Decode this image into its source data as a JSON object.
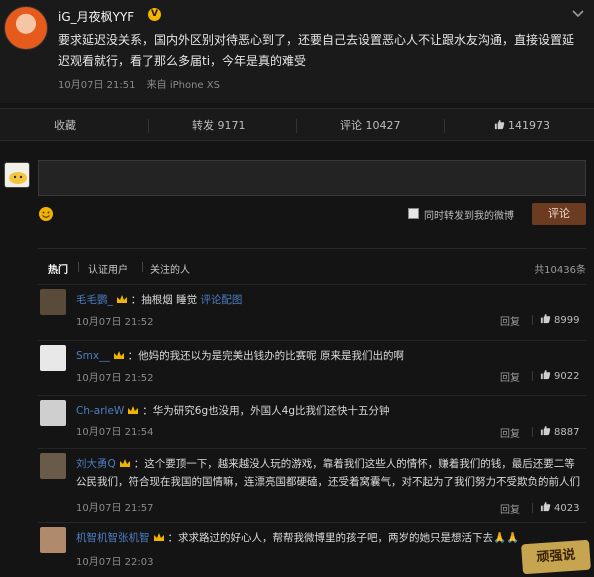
{
  "post": {
    "author": "iG_月夜枫YYF",
    "text": "要求延迟没关系，国内外区别对待恶心到了，还要自己去设置恶心人不让跟水友沟通，直接设置延迟观看就行，看了那么多届ti，今年是真的难受",
    "time": "10月07日 21:51",
    "source": "来自 iPhone XS"
  },
  "actions": {
    "collect": "收藏",
    "repost": "转发 9171",
    "comment": "评论 10427",
    "likes": "141973"
  },
  "compose": {
    "repost_label": "同时转发到我的微博",
    "submit_label": "评论"
  },
  "tabs": {
    "hot": "热门",
    "verified": "认证用户",
    "following": "关注的人",
    "total": "共10436条"
  },
  "comments": [
    {
      "name": "毛毛鹦_",
      "text": "：抽根烟 睡觉",
      "link": "评论配图",
      "time": "10月07日 21:52",
      "reply": "回复",
      "likes": "8999"
    },
    {
      "name": "Smx__",
      "text": "：他妈的我还以为是完美出钱办的比赛呢 原来是我们出的啊",
      "link": "",
      "time": "10月07日 21:52",
      "reply": "回复",
      "likes": "9022"
    },
    {
      "name": "Ch-arleW",
      "text": "：华为研究6g也没用，外国人4g比我们还快十五分钟",
      "link": "",
      "time": "10月07日 21:54",
      "reply": "回复",
      "likes": "8887"
    },
    {
      "name": "刘大勇Q",
      "text": "：这个要顶一下，越来越没人玩的游戏，靠着我们这些人的情怀，赚着我们的钱，最后还要二等公民我们，符合现在我国的国情嘛，连漂亮国都硬磕，还受着窝囊气，对不起为了我们努力不受欺负的前人们",
      "link": "",
      "time": "10月07日 21:57",
      "reply": "回复",
      "likes": "4023"
    },
    {
      "name": "机智机智张机智",
      "text": "：求求路过的好心人，帮帮我微博里的孩子吧，两岁的她只是想活下去🙏🙏",
      "link": "",
      "time": "10月07日 22:03",
      "reply": "回复",
      "likes": ""
    }
  ],
  "watermark": "顽强说",
  "colors": {
    "link": "#4c7ec2",
    "accent": "#6b3b22",
    "vip": "#f6b300"
  }
}
